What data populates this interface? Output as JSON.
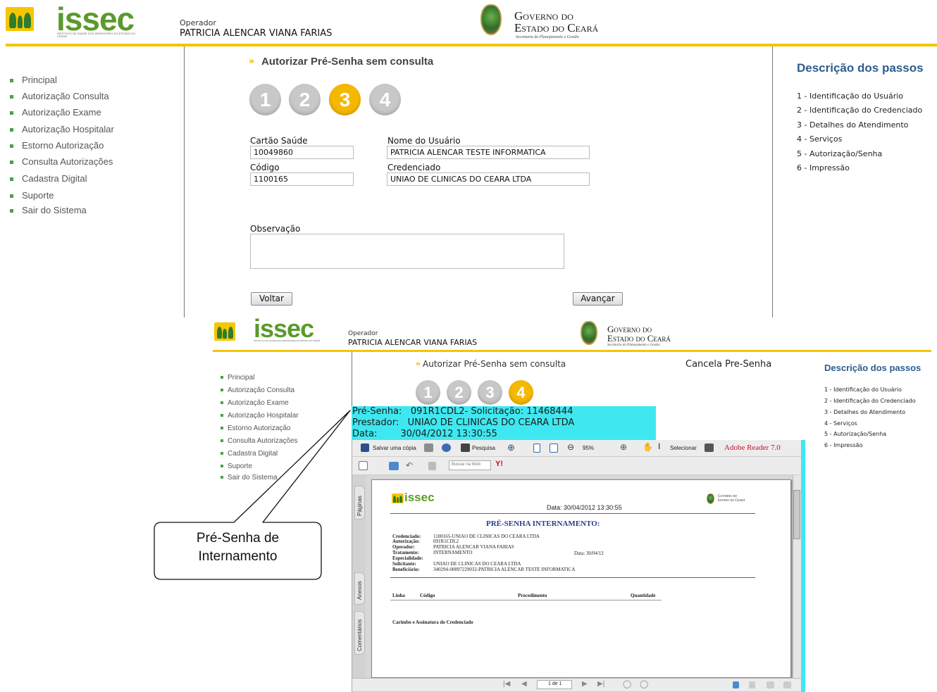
{
  "top": {
    "logo_text": "issec",
    "logo_subtitle": "INSTITUTO DE SAÚDE DOS SERVIDORES DO ESTADO DO CEARÁ",
    "operator_label": "Operador",
    "operator_name": "PATRICIA ALENCAR VIANA FARIAS",
    "gov_line1": "Governo do",
    "gov_line2": "Estado do Ceará",
    "gov_sub": "Secretaria do Planejamento e Gestão"
  },
  "menu": [
    "Principal",
    "Autorização Consulta",
    "Autorização Exame",
    "Autorização Hospitalar",
    "Estorno Autorização",
    "Consulta Autorizações",
    "Cadastra Digital",
    "Suporte",
    "Sair do Sistema"
  ],
  "page_title": "Autorizar Pré-Senha sem consulta",
  "steps": [
    "1",
    "2",
    "3",
    "4"
  ],
  "form": {
    "cartao_label": "Cartão Saúde",
    "cartao_value": "10049860",
    "nome_label": "Nome do Usuário",
    "nome_value": "PATRICIA ALENCAR TESTE INFORMATICA",
    "codigo_label": "Código",
    "codigo_value": "1100165",
    "credenciado_label": "Credenciado",
    "credenciado_value": "UNIAO DE CLINICAS DO CEARA LTDA",
    "obs_label": "Observação",
    "voltar": "Voltar",
    "avancar": "Avançar"
  },
  "steps_panel": {
    "title": "Descrição dos passos",
    "items": [
      "1 - Identificação do Usuário",
      "2 - Identificação do Credenciado",
      "3 - Detalhes do Atendimento",
      "4 - Serviços",
      "5 - Autorização/Senha",
      "6 - Impressão"
    ]
  },
  "second": {
    "title": "Autorizar Pré-Senha sem consulta",
    "cancel": "Cancela Pre-Senha",
    "cyan_lines": [
      "Pré-Senha:   091R1CDL2- Solicitação: 11468444",
      "Prestador:   UNIAO DE CLINICAS DO CEARA LTDA",
      "Data:        30/04/2012 13:30:55"
    ]
  },
  "reader": {
    "save_copy": "Salvar uma cópia",
    "search": "Pesquisa",
    "zoom": "95%",
    "select": "Selecionar",
    "brand": "Adobe Reader 7.0",
    "web_search": "Buscar na Web",
    "tab_pages": "Páginas",
    "tab_attach": "Anexos",
    "tab_comments": "Comentários",
    "page_indicator": "1 de 1"
  },
  "doc": {
    "date": "Data: 30/04/2012 13:30:55",
    "heading": "PRÉ-SENHA INTERNAMENTO:",
    "rows": [
      {
        "label": "Credenciado:",
        "value": "1100165-UNIAO DE CLINICAS DO CEARA LTDA"
      },
      {
        "label": "Autorização:",
        "value": "091R1CDL2"
      },
      {
        "label": "Operador:",
        "value": "PATRICIA ALENCAR VIANA FARIAS"
      },
      {
        "label": "Tratamento:",
        "value": "INTERNAMENTO"
      },
      {
        "label": "Especialidade:",
        "value": ""
      },
      {
        "label": "Solicitante:",
        "value": "UNIAO DE CLINICAS DO CEARA LTDA"
      },
      {
        "label": "Beneficiário:",
        "value": "340294-00897229032-PATRICIA ALENCAR TESTE INFORMATICA"
      }
    ],
    "date_short": "Data: 30/04/12",
    "col_linha": "Linha",
    "col_codigo": "Código",
    "col_procedimento": "Procedimento",
    "col_quantidade": "Quantidade",
    "footer": "Carimbo e Assinatura do Credenciado"
  },
  "callout": {
    "text": "Pré-Senha de\nInternamento"
  }
}
